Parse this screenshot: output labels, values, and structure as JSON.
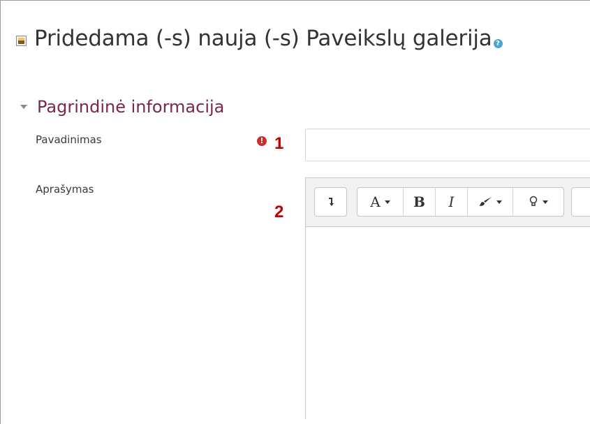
{
  "page": {
    "title": "Pridedama (-s) nauja (-s) Paveikslų galerija",
    "help_glyph": "?"
  },
  "section": {
    "label": "Pagrindinė informacija"
  },
  "fields": {
    "name_label": "Pavadinimas",
    "name_value": "",
    "required_glyph": "!",
    "description_label": "Aprašymas"
  },
  "annotations": {
    "one": "1",
    "two": "2"
  },
  "editor": {
    "toolbar": {
      "bold_label": "B",
      "italic_label": "I",
      "font_label": "A"
    },
    "content": ""
  },
  "colors": {
    "section_color": "#7a2750",
    "required_color": "#c9302c",
    "annotation_color": "#c00000",
    "help_color": "#4aa6cf"
  }
}
